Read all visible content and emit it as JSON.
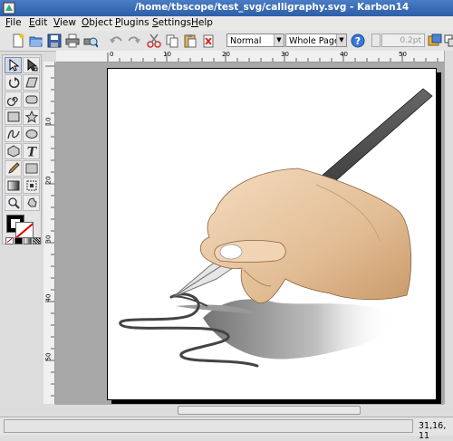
{
  "window": {
    "title": "/home/tbscope/test_svg/calligraphy.svg - Karbon14"
  },
  "menu": [
    "File",
    "Edit",
    "View",
    "Object",
    "Plugins",
    "Settings",
    "Help"
  ],
  "toolbar": {
    "view_mode": "Normal",
    "zoom": "Whole Page",
    "stroke_width": "0.2pt"
  },
  "ruler": {
    "h_ticks": [
      "0",
      "10",
      "20",
      "30",
      "40",
      "50"
    ],
    "v_ticks": [
      "10",
      "20",
      "30",
      "40",
      "50"
    ]
  },
  "status": {
    "coords": "31,16, 11"
  }
}
